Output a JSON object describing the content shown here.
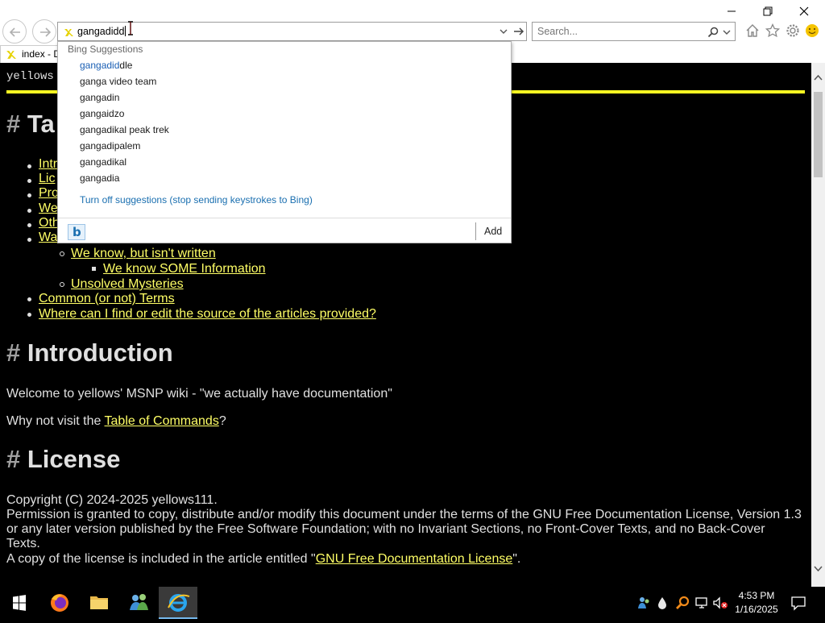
{
  "browser": {
    "address": {
      "typed": "gangadidd"
    },
    "search": {
      "placeholder": "Search..."
    },
    "tab": {
      "label": "index - D"
    }
  },
  "suggestions": {
    "header": "Bing Suggestions",
    "items": [
      {
        "typed": "gangadid",
        "rest": "dle"
      },
      {
        "typed": "",
        "rest": "ganga video team"
      },
      {
        "typed": "",
        "rest": "gangadin"
      },
      {
        "typed": "",
        "rest": "gangaidzo"
      },
      {
        "typed": "",
        "rest": "gangadikal peak trek"
      },
      {
        "typed": "",
        "rest": "gangadipalem"
      },
      {
        "typed": "",
        "rest": "gangadikal"
      },
      {
        "typed": "",
        "rest": "gangadia"
      }
    ],
    "turn_off": "Turn off suggestions (stop sending keystrokes to Bing)",
    "add_label": "Add",
    "bing_glyph": "b"
  },
  "page": {
    "site_name": "yellows",
    "toc_heading_hash": "#",
    "toc_heading": "Ta",
    "toc_partial": [
      "Intr",
      "Lic",
      "Pro",
      "We",
      "Oth",
      "Wa"
    ],
    "toc_sub": [
      {
        "label": "We know, but isn't written",
        "level": 2
      },
      {
        "label": "We know SOME Information",
        "level": 3
      },
      {
        "label": "Unsolved Mysteries",
        "level": 2
      },
      {
        "label": "Common (or not) Terms",
        "level": 1
      },
      {
        "label": "Where can I find or edit the source of the articles provided?",
        "level": 1
      }
    ],
    "intro_heading": "Introduction",
    "intro_p1": "Welcome to yellows' MSNP wiki - \"we actually have documentation\"",
    "intro_p2_before": "Why not visit the ",
    "intro_p2_link": "Table of Commands",
    "intro_p2_after": "?",
    "license_heading": "License",
    "license_l1": "Copyright (C) 2024-2025 yellows111.",
    "license_l2": "Permission is granted to copy, distribute and/or modify this document under the terms of the GNU Free Documentation License, Version 1.3",
    "license_l3": "or any later version published by the Free Software Foundation; with no Invariant Sections, no Front-Cover Texts, and no Back-Cover",
    "license_l4": "Texts.",
    "license_l5_before": "A copy of the license is included in the article entitled \"",
    "license_l5_link": "GNU Free Documentation License",
    "license_l5_after": "\"."
  },
  "taskbar": {
    "time": "4:53 PM",
    "date": "1/16/2025"
  },
  "colors": {
    "link_yellow": "#ffff66",
    "rule_yellow": "#ffff22",
    "suggest_blue": "#1a6fb0"
  }
}
